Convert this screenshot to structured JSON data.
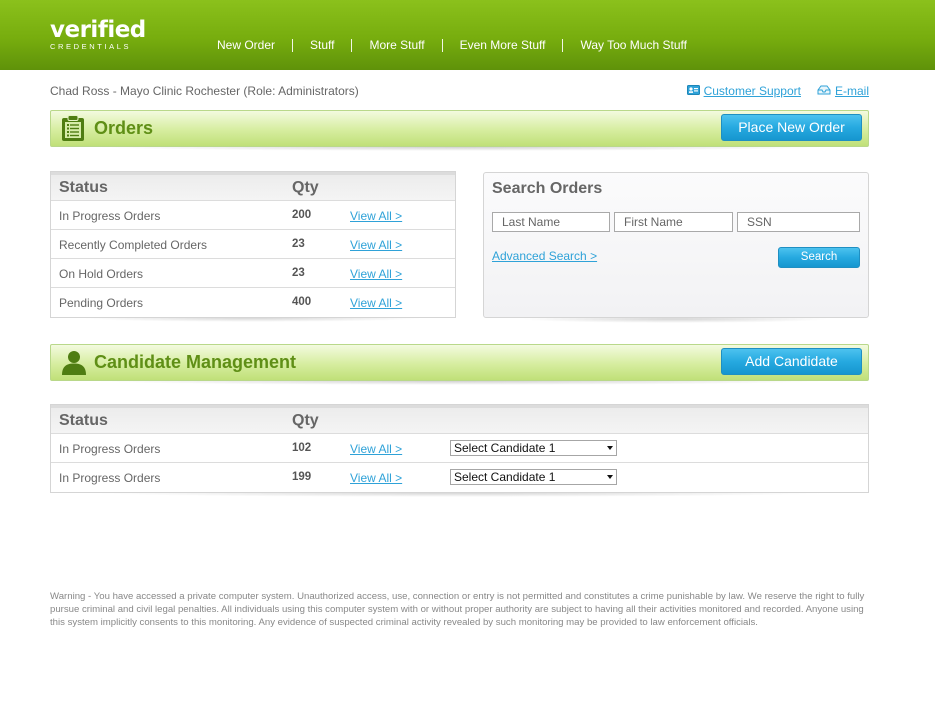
{
  "header": {
    "logo_main": "verified",
    "logo_sub": "CREDENTIALS",
    "nav": [
      "New Order",
      "Stuff",
      "More Stuff",
      "Even More Stuff",
      "Way Too Much Stuff"
    ]
  },
  "user_info": "Chad Ross - Mayo Clinic Rochester (Role: Administrators)",
  "top_links": {
    "support": "Customer Support",
    "email": "E-mail"
  },
  "orders_section": {
    "title": "Orders",
    "button": "Place New Order"
  },
  "orders_table": {
    "headers": [
      "Status",
      "Qty"
    ],
    "rows": [
      {
        "status": "In Progress Orders",
        "qty": "200",
        "link": "View All >"
      },
      {
        "status": "Recently Completed Orders",
        "qty": "23",
        "link": "View All >"
      },
      {
        "status": "On Hold Orders",
        "qty": "23",
        "link": "View All >"
      },
      {
        "status": "Pending Orders",
        "qty": "400",
        "link": "View All >"
      }
    ]
  },
  "search": {
    "title": "Search Orders",
    "last_name": "Last Name",
    "first_name": "First Name",
    "ssn": "SSN",
    "advanced": "Advanced Search >",
    "button": "Search"
  },
  "candidate_section": {
    "title": "Candidate Management",
    "button": "Add Candidate"
  },
  "candidate_table": {
    "headers": [
      "Status",
      "Qty"
    ],
    "rows": [
      {
        "status": "In Progress Orders",
        "qty": "102",
        "link": "View All >",
        "select": "Select Candidate 1"
      },
      {
        "status": "In Progress Orders",
        "qty": "199",
        "link": "View All >",
        "select": "Select Candidate 1"
      }
    ]
  },
  "warning": "Warning - You have accessed a private computer system. Unauthorized access, use, connection or entry is not permitted and constitutes a crime punishable by law. We reserve the right to fully pursue criminal and civil legal penalties. All individuals using this computer system with or without proper authority are subject to having all their activities monitored and recorded. Anyone using this system implicitly consents to this monitoring. Any evidence of suspected criminal activity revealed by such monitoring may be provided to law enforcement officials.",
  "colors": {
    "header_green": "#77ad0e",
    "section_title_green": "#5f8f16",
    "link_blue": "#2fa2d8",
    "button_blue": "#26a9e0"
  }
}
